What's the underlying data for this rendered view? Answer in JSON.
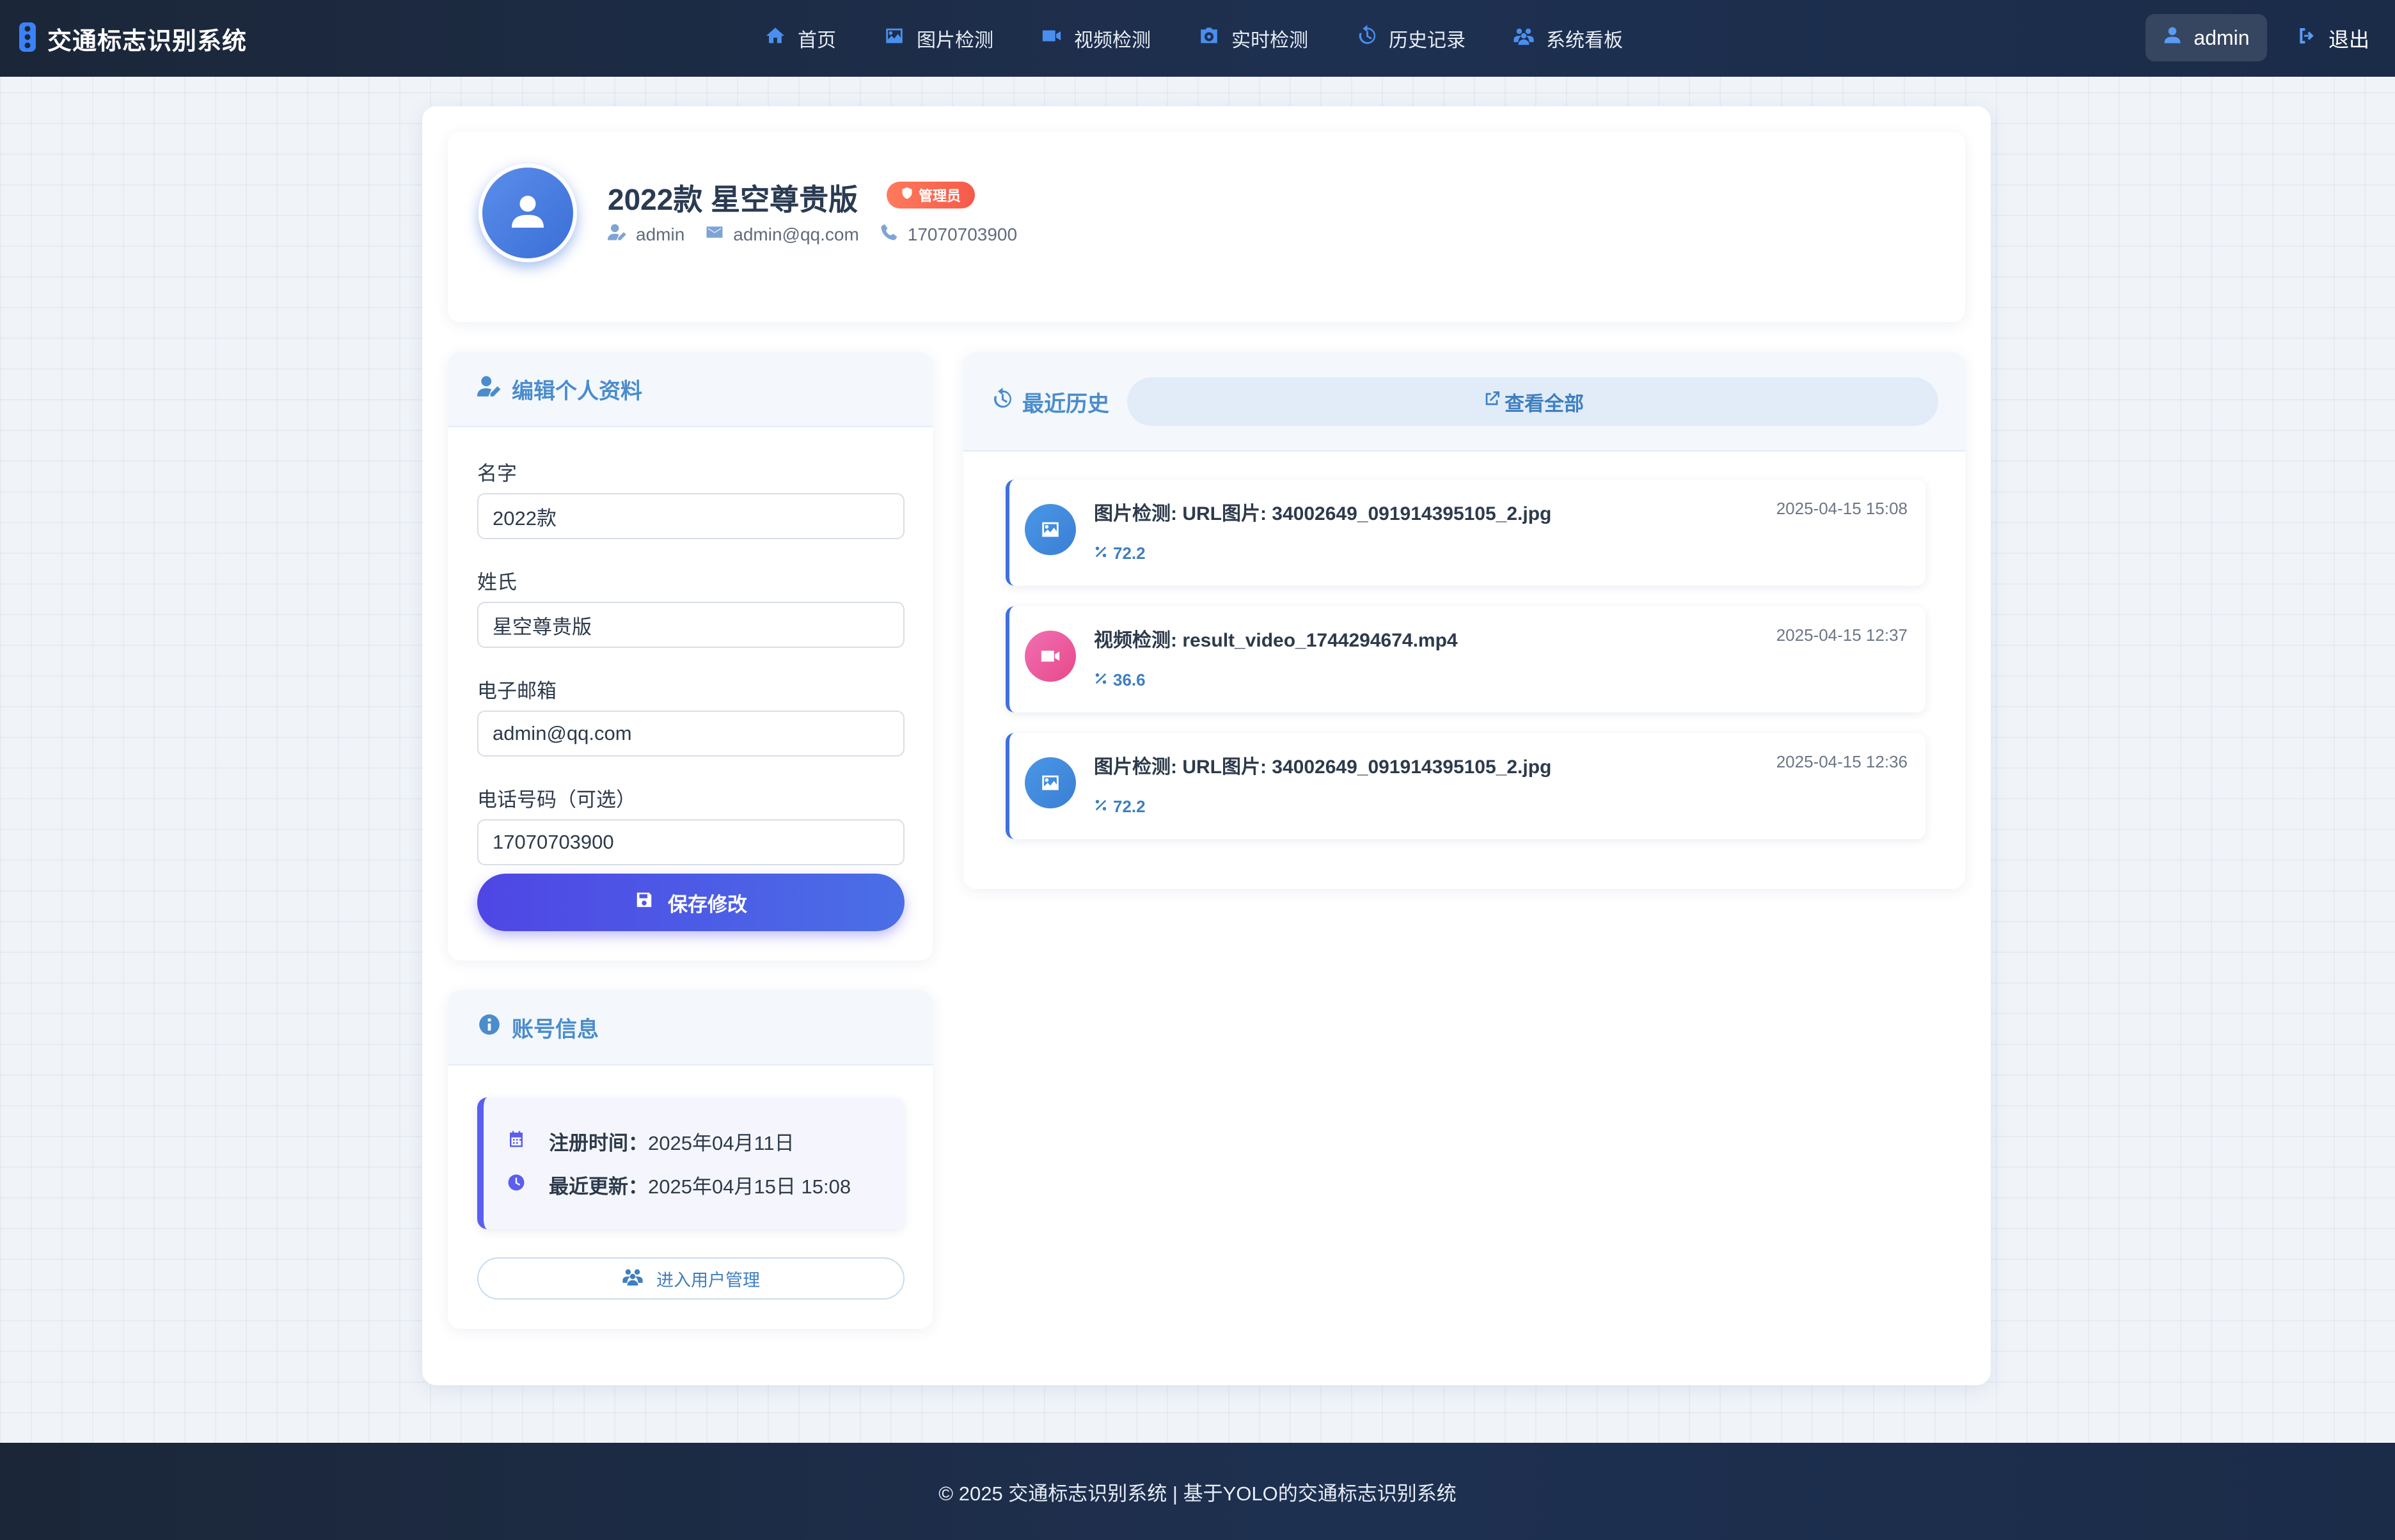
{
  "nav": {
    "brand": "交通标志识别系统",
    "links": [
      "首页",
      "图片检测",
      "视频检测",
      "实时检测",
      "历史记录",
      "系统看板"
    ],
    "user": "admin",
    "logout": "退出"
  },
  "profile": {
    "name": "2022款 星空尊贵版",
    "role": "管理员",
    "username": "admin",
    "email": "admin@qq.com",
    "phone": "17070703900"
  },
  "edit": {
    "title": "编辑个人资料",
    "first_name_label": "名字",
    "first_name_value": "2022款",
    "last_name_label": "姓氏",
    "last_name_value": "星空尊贵版",
    "email_label": "电子邮箱",
    "email_value": "admin@qq.com",
    "phone_label": "电话号码（可选）",
    "phone_value": "17070703900",
    "save_label": "保存修改"
  },
  "account": {
    "title": "账号信息",
    "registered_label": "注册时间：",
    "registered_value": "2025年04月11日",
    "updated_label": "最近更新：",
    "updated_value": "2025年04月15日 15:08",
    "user_mgmt_label": "进入用户管理"
  },
  "history": {
    "title": "最近历史",
    "view_all": "查看全部",
    "items": [
      {
        "type": "image",
        "title": "图片检测: URL图片: 34002649_091914395105_2.jpg",
        "score": "72.2",
        "time": "2025-04-15 15:08"
      },
      {
        "type": "video",
        "title": "视频检测: result_video_1744294674.mp4",
        "score": "36.6",
        "time": "2025-04-15 12:37"
      },
      {
        "type": "image",
        "title": "图片检测: URL图片: 34002649_091914395105_2.jpg",
        "score": "72.2",
        "time": "2025-04-15 12:36"
      }
    ]
  },
  "footer": {
    "text": "© 2025 交通标志识别系统 | 基于YOLO的交通标志识别系统"
  },
  "colors": {
    "accent": "#4f46e5",
    "link_blue": "#3f7fbf",
    "nav_bg": "#1b2638",
    "role_badge": "#f65a4a",
    "video_icon": "#e64a8a"
  }
}
